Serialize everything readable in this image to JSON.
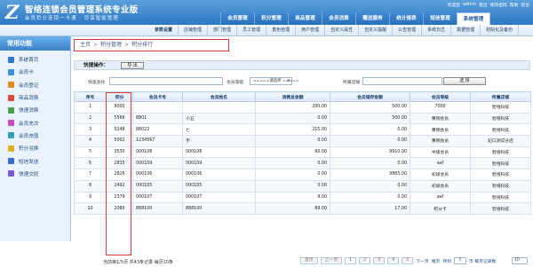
{
  "app": {
    "logo_glyph": "Z",
    "title": "智络连锁会员管理系统专业版",
    "slogan": "会员积分连锁一卡通 · 尽享智能管理"
  },
  "topbar": [
    "欢迎您",
    "admin",
    "退出",
    "修改密码",
    "帮助",
    "前台"
  ],
  "main_nav": [
    {
      "label": "会员管理",
      "active": false
    },
    {
      "label": "积分管理",
      "active": false
    },
    {
      "label": "商品管理",
      "active": false
    },
    {
      "label": "会员消费",
      "active": false
    },
    {
      "label": "赠送服务",
      "active": false
    },
    {
      "label": "统计报表",
      "active": false
    },
    {
      "label": "短信管理",
      "active": false
    },
    {
      "label": "系统管理",
      "active": true
    }
  ],
  "sub_nav": [
    {
      "label": "参数设置",
      "active": true
    },
    {
      "label": "店铺管理",
      "active": false
    },
    {
      "label": "部门管理",
      "active": false
    },
    {
      "label": "员工管理",
      "active": false
    },
    {
      "label": "角色管理",
      "active": false
    },
    {
      "label": "用户管理",
      "active": false
    },
    {
      "label": "自定义属性",
      "active": false
    },
    {
      "label": "自定义提醒",
      "active": false
    },
    {
      "label": "公告管理",
      "active": false
    },
    {
      "label": "系统日志",
      "active": false
    },
    {
      "label": "数据管理",
      "active": false
    },
    {
      "label": "初始化及备份",
      "active": false
    }
  ],
  "sidebar": {
    "title": "常用功能",
    "items": [
      {
        "label": "系统首页",
        "color": "#2f7ad0"
      },
      {
        "label": "会员卡",
        "color": "#3a8fdc"
      },
      {
        "label": "会员登记",
        "color": "#e08a20"
      },
      {
        "label": "商品消费",
        "color": "#d94a3a"
      },
      {
        "label": "快速消费",
        "color": "#4aa04a"
      },
      {
        "label": "会员充次",
        "color": "#c94ac0"
      },
      {
        "label": "会员充值",
        "color": "#2fa0b8"
      },
      {
        "label": "积分兑换",
        "color": "#e0b020"
      },
      {
        "label": "短信发送",
        "color": "#3a6fd0"
      },
      {
        "label": "快速交班",
        "color": "#7a5ad0"
      }
    ]
  },
  "breadcrumb": [
    "主页",
    "积分管理",
    "积分排行"
  ],
  "quick_bar": {
    "label": "快捷操作：",
    "export_label": "导 出"
  },
  "filters": {
    "search_label": "快速查找",
    "level_label": "会员等级",
    "level_value": "=====请选择 =====",
    "store_label": "所属店铺",
    "select_btn": "选 择"
  },
  "table": {
    "headers": [
      "序号",
      "积分",
      "会员卡号",
      "会员姓名",
      "消费总金额",
      "会员储存金额",
      "会员等级",
      "所属店铺"
    ],
    "rows": [
      [
        "1",
        "9000",
        "",
        "",
        "200.00",
        "500.00",
        "7000",
        "智络科技"
      ],
      [
        "2",
        "5566",
        "8801",
        "小五",
        "0.00",
        "500.00",
        "黄铜会员",
        "智络科技"
      ],
      [
        "3",
        "5248",
        "88022",
        "七",
        "215.00",
        "0.00",
        "黄铜会员",
        "智络科技"
      ],
      [
        "4",
        "5002",
        "1234567",
        "字",
        "0.00",
        "0.00",
        "黄铜会员",
        "妃口测试分店"
      ],
      [
        "5",
        "3530",
        "000108",
        "000108",
        "90.00",
        "9910.00",
        "中级会员",
        "智络科技"
      ],
      [
        "6",
        "2835",
        "000109",
        "000109",
        "0.00",
        "0.00",
        "aaf",
        "智络科技"
      ],
      [
        "7",
        "2826",
        "000106",
        "000106",
        "0.00",
        "9865.00",
        "初级会员",
        "智络科技"
      ],
      [
        "8",
        "2492",
        "000105",
        "000105",
        "0.00",
        "0.00",
        "初级会员",
        "智络科技"
      ],
      [
        "9",
        "2379",
        "000107",
        "000107",
        "9.00",
        "0.00",
        "aaf",
        "智络科技"
      ],
      [
        "10",
        "2080",
        "888100",
        "888100",
        "89.00",
        "17.00",
        "积分卡",
        "智络科技"
      ]
    ]
  },
  "footer": {
    "info": "当前第1/5页 共43条记录 每页10条",
    "first": "首页",
    "prev": "上一页",
    "pages": [
      "1",
      "2",
      "3",
      "4",
      "5"
    ],
    "next": "下一页",
    "last": "尾页",
    "jump_text": "转到",
    "page_input": "1",
    "page_suffix": "页 每页记录数",
    "page_size": "10"
  }
}
